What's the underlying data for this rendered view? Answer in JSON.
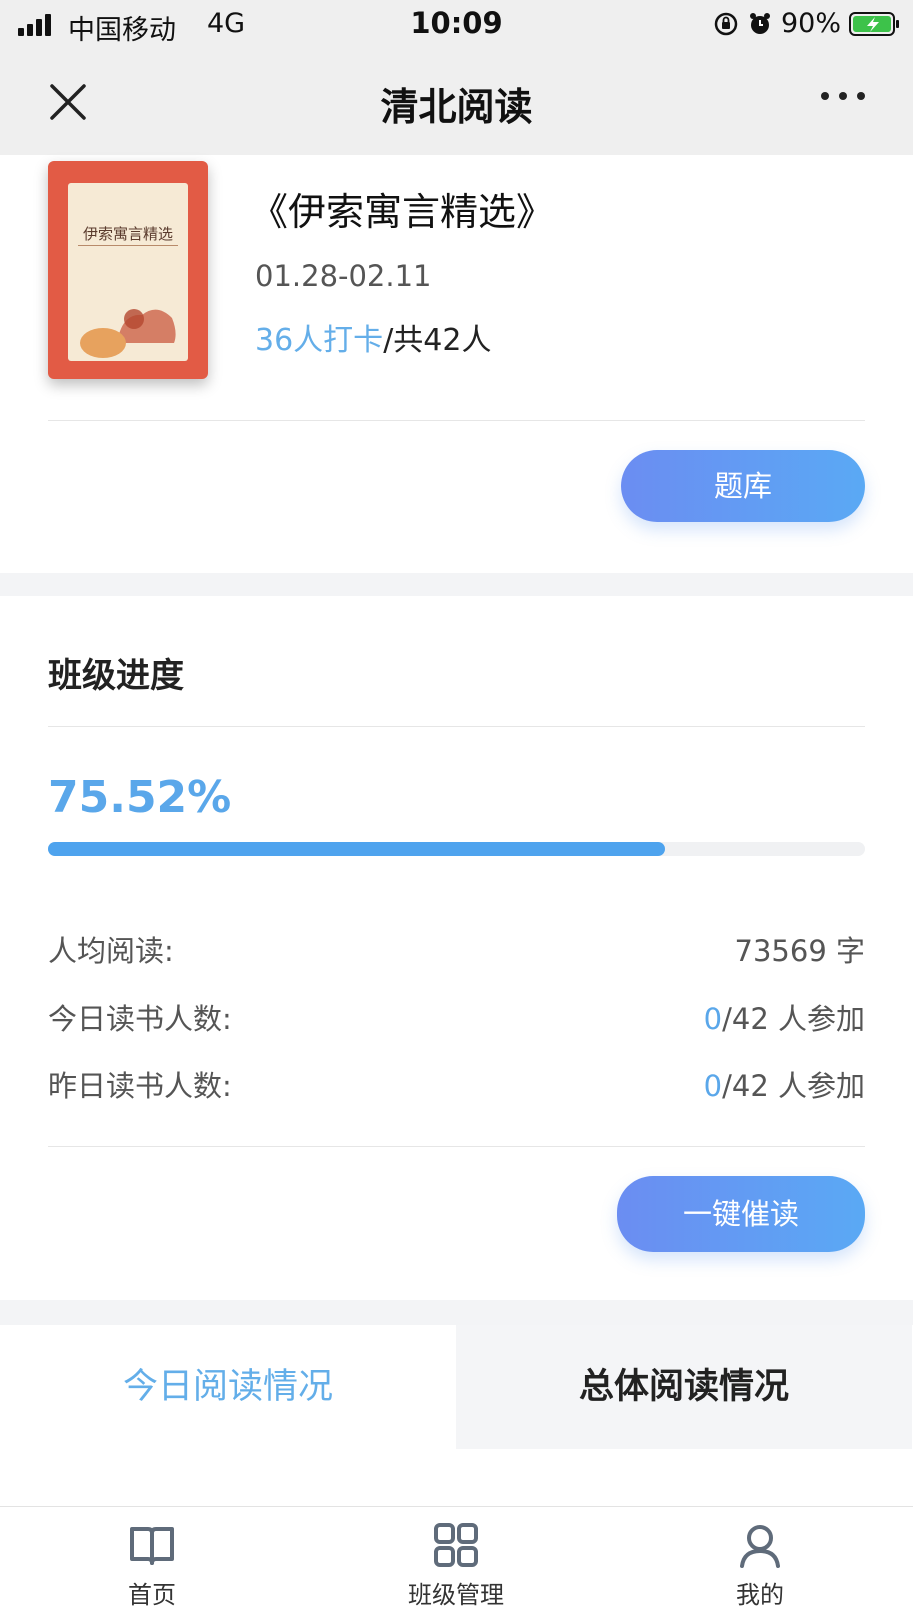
{
  "status_bar": {
    "carrier": "中国移动",
    "network": "4G",
    "time": "10:09",
    "battery_text": "90%",
    "icons": [
      "signal-icon",
      "orientation-lock-icon",
      "alarm-icon",
      "battery-charging-icon"
    ]
  },
  "nav": {
    "title": "清北阅读",
    "close_icon": "close-icon",
    "more_icon": "more-icon"
  },
  "book": {
    "cover_title": "伊索寓言精选",
    "title": "《伊索寓言精选》",
    "dates": "01.28-02.11",
    "checkin_count": "36人打卡",
    "checkin_total": "/共42人",
    "question_bank_label": "题库"
  },
  "class_progress": {
    "title": "班级进度",
    "percent_text": "75.52%",
    "percent_value": 75.52,
    "stats": [
      {
        "label": "人均阅读:",
        "value": "73569 字"
      },
      {
        "label": "今日读书人数:",
        "value_highlight": "0",
        "value_rest": "/42 人参加"
      },
      {
        "label": "昨日读书人数:",
        "value_highlight": "0",
        "value_rest": "/42 人参加"
      }
    ],
    "urge_label": "一键催读"
  },
  "tabs": [
    {
      "label": "今日阅读情况",
      "active": true
    },
    {
      "label": "总体阅读情况",
      "active": false
    }
  ],
  "bottom_nav": [
    {
      "label": "首页",
      "icon": "book-icon"
    },
    {
      "label": "班级管理",
      "icon": "grid-icon"
    },
    {
      "label": "我的",
      "icon": "user-icon"
    }
  ],
  "colors": {
    "accent": "#5aa7ea",
    "button_gradient_start": "#6b8df2",
    "button_gradient_end": "#5aa9f4",
    "cover_red": "#e25b45"
  }
}
